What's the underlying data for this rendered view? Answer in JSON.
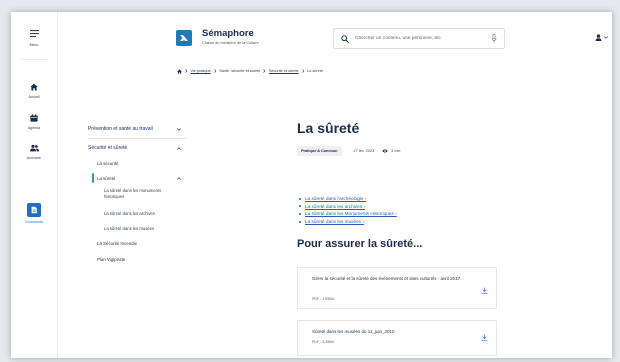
{
  "app": {
    "name": "Sémaphore",
    "tagline": "Chaîne du ministère de la Culture",
    "logo_icon": "semaphore-logo-icon"
  },
  "rail": {
    "items": [
      {
        "label": "Menu",
        "icon": "menu-icon"
      },
      {
        "label": "Accueil",
        "icon": "home-icon"
      },
      {
        "label": "Agenda",
        "icon": "calendar-icon"
      },
      {
        "label": "Annuaire",
        "icon": "people-icon"
      },
      {
        "label": "Documents",
        "icon": "document-icon"
      }
    ]
  },
  "search": {
    "placeholder": "Chercher un contenu, une personne, etc",
    "icon": "search-icon",
    "voice_icon": "microphone-icon"
  },
  "user_menu": {
    "icon": "user-icon",
    "chevron": "chevron-down-icon"
  },
  "breadcrumb": {
    "home_icon": "home-icon",
    "items": [
      "Vie pratique",
      "Santé, sécurité et sûreté",
      "Sécurité et sûreté",
      "La sûreté"
    ]
  },
  "sidebar": {
    "items": [
      {
        "label": "Prévention et santé au travail",
        "expanded": false
      },
      {
        "label": "Sécurité et sûreté",
        "expanded": true
      },
      {
        "label": "La sécurité"
      },
      {
        "label": "La sûreté",
        "active": true,
        "expanded": true
      },
      {
        "label": "La sûreté dans les monuments historiques"
      },
      {
        "label": "La sûreté dans les archives"
      },
      {
        "label": "La sûreté dans les musées"
      },
      {
        "label": "La Sécurité Incendie"
      },
      {
        "label": "Plan Vigipirate"
      }
    ]
  },
  "article": {
    "title": "La sûreté",
    "category": "Pratique & Commun",
    "date": "27 fév. 2023",
    "reading_time": "3 min",
    "reading_icon": "eye-icon",
    "links": [
      "La sûreté dans l'archéologie ›",
      "La sûreté dans les archives ›",
      "La sûreté dans les Monuments Historiques ›",
      "La sûreté dans les musées ›"
    ],
    "section_heading": "Pour assurer la sûreté...",
    "documents": [
      {
        "title": "Gérer la sécurité et la sûreté des événements et sites culturels - avril 2017",
        "meta": "PDF - 1,53Mo",
        "icon": "download-icon"
      },
      {
        "title": "Sûreté dans les musées du 11_juin_2010",
        "meta": "PDF - 3,48Mo",
        "icon": "download-icon"
      }
    ]
  },
  "colors": {
    "brand": "#1f7ab8",
    "active_marker": "#2aa79b",
    "link": "#2b5cb4",
    "text": "#1b2a4e",
    "documents_button": "#1f6fc8",
    "download": "#5b82d0"
  }
}
